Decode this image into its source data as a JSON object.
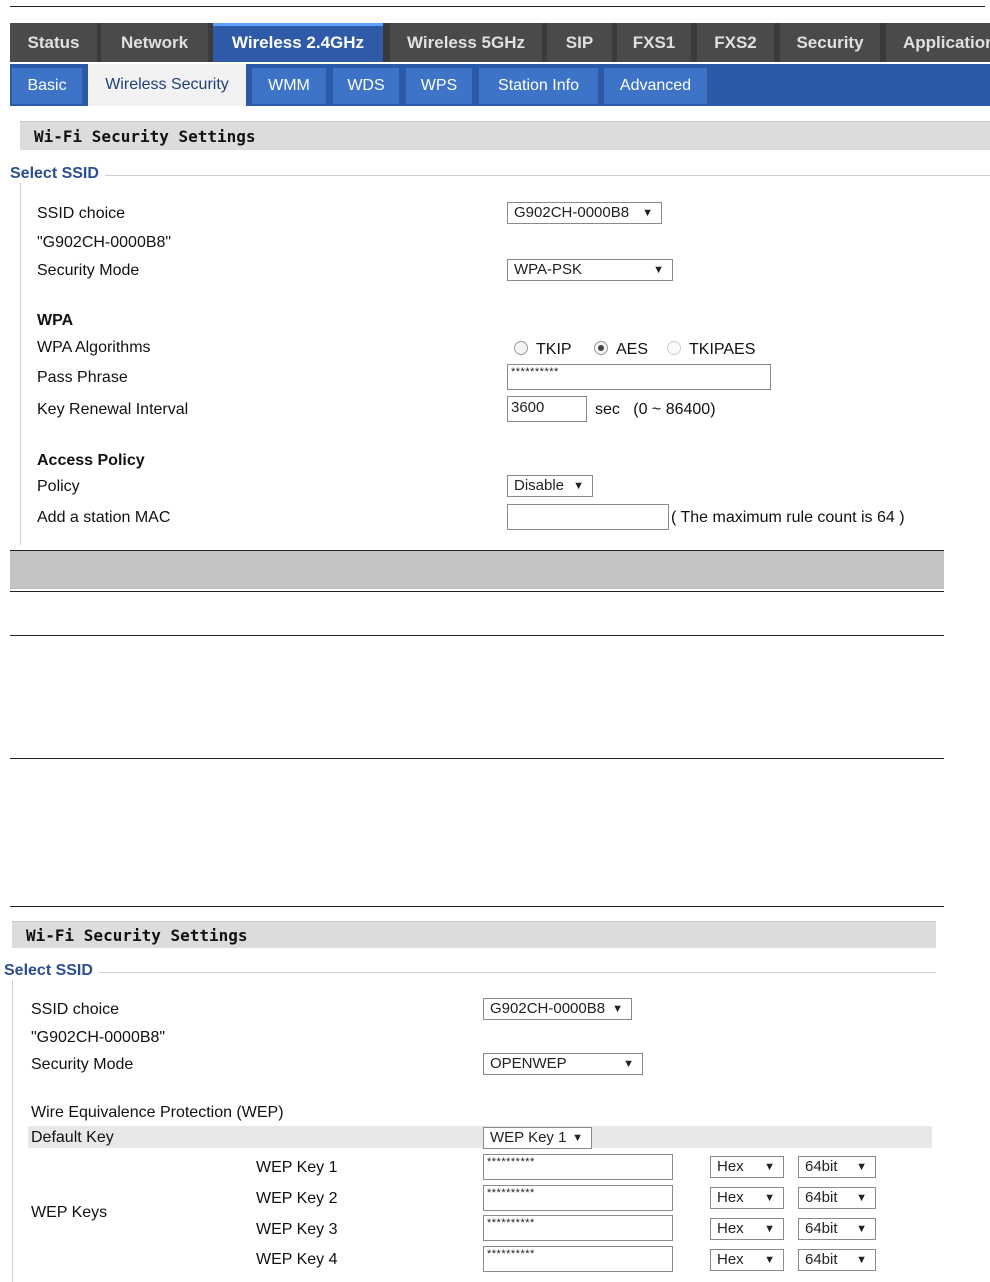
{
  "nav": {
    "tabs": [
      "Status",
      "Network",
      "Wireless 2.4GHz",
      "Wireless 5GHz",
      "SIP",
      "FXS1",
      "FXS2",
      "Security",
      "Application"
    ]
  },
  "subnav": {
    "tabs": [
      "Basic",
      "Wireless Security",
      "WMM",
      "WDS",
      "WPS",
      "Station Info",
      "Advanced"
    ]
  },
  "panel1": {
    "header": "Wi-Fi Security Settings",
    "legend": "Select SSID",
    "ssid_choice_label": "SSID choice",
    "ssid_choice_value": "G902CH-0000B8",
    "ssid_name": "\"G902CH-0000B8\"",
    "security_mode_label": "Security Mode",
    "security_mode_value": "WPA-PSK",
    "wpa_heading": "WPA",
    "wpa_algorithms_label": "WPA Algorithms",
    "alg_tkip": "TKIP",
    "alg_aes": "AES",
    "alg_tkipaes": "TKIPAES",
    "pass_phrase_label": "Pass Phrase",
    "pass_phrase_value": "**********",
    "key_renewal_label": "Key Renewal Interval",
    "key_renewal_value": "3600",
    "key_renewal_unit": "sec   (0 ~ 86400)",
    "access_policy_heading": "Access Policy",
    "policy_label": "Policy",
    "policy_value": "Disable",
    "add_mac_label": "Add a station MAC",
    "add_mac_value": "",
    "max_rule_note": "( The maximum rule count is 64 )"
  },
  "panel2": {
    "header": "Wi-Fi Security Settings",
    "legend": "Select SSID",
    "ssid_choice_label": "SSID choice",
    "ssid_choice_value": "G902CH-0000B8",
    "ssid_name": "\"G902CH-0000B8\"",
    "security_mode_label": "Security Mode",
    "security_mode_value": "OPENWEP",
    "wep_heading": "Wire Equivalence Protection (WEP)",
    "default_key_label": "Default Key",
    "default_key_value": "WEP Key 1",
    "wep_keys_label": "WEP Keys",
    "keys": [
      {
        "label": "WEP Key 1",
        "value": "**********",
        "format": "Hex",
        "length": "64bit"
      },
      {
        "label": "WEP Key 2",
        "value": "**********",
        "format": "Hex",
        "length": "64bit"
      },
      {
        "label": "WEP Key 3",
        "value": "**********",
        "format": "Hex",
        "length": "64bit"
      },
      {
        "label": "WEP Key 4",
        "value": "**********",
        "format": "Hex",
        "length": "64bit"
      }
    ]
  },
  "colors": {
    "nav_bg": "#3b3b3b",
    "nav_active": "#2e5aa8",
    "subnav_bg": "#2b5ba8",
    "legend_text": "#2a4e8f",
    "header_bg": "#dcdcdc"
  }
}
